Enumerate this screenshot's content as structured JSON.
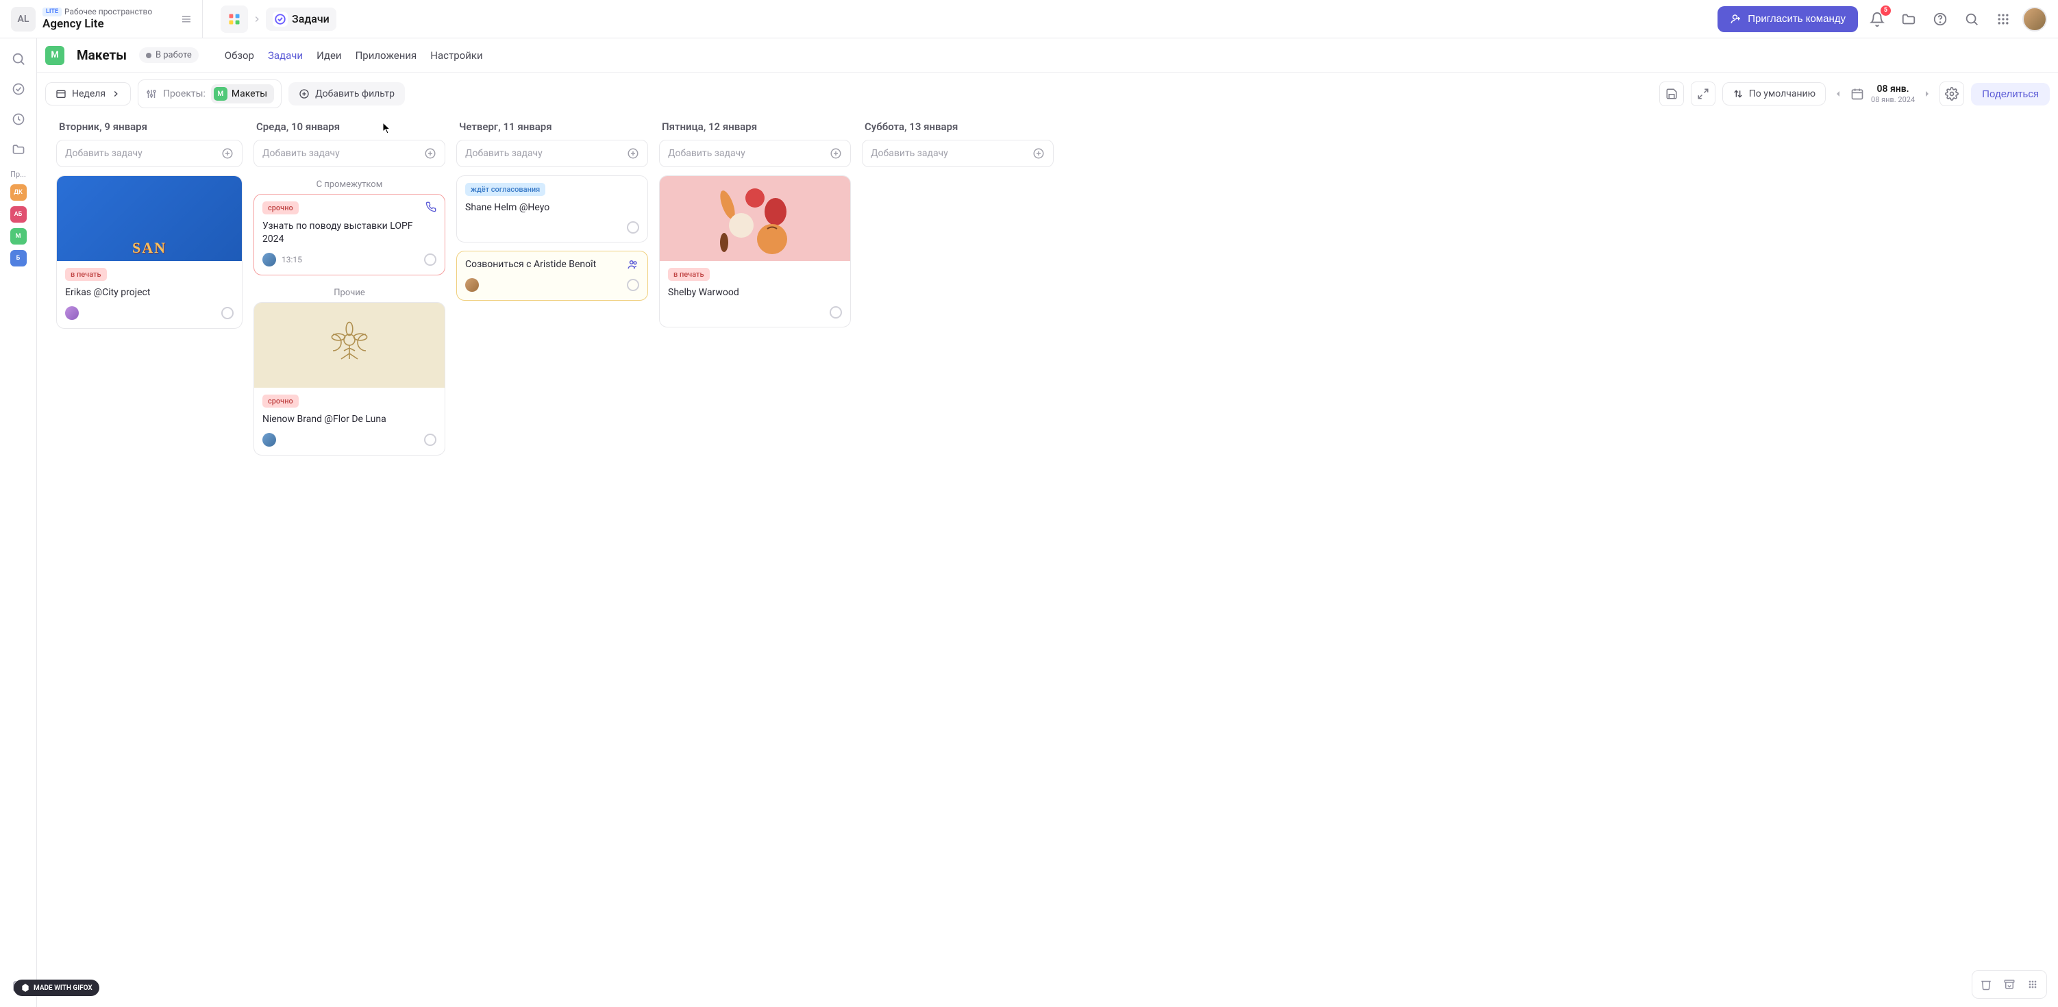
{
  "workspace": {
    "badge": "AL",
    "lite": "LITE",
    "sublabel": "Рабочее пространство",
    "name": "Agency Lite"
  },
  "breadcrumb": {
    "page": "Задачи"
  },
  "top_actions": {
    "invite": "Пригласить команду",
    "notif_count": "5"
  },
  "sidebar": {
    "projects_label": "Пр...",
    "avatars": [
      {
        "label": "ДК"
      },
      {
        "label": "АБ"
      },
      {
        "label": "М"
      },
      {
        "label": "Б"
      }
    ]
  },
  "subheader": {
    "proj_badge": "М",
    "proj_title": "Макеты",
    "status": "В работе",
    "nav": {
      "overview": "Обзор",
      "tasks": "Задачи",
      "ideas": "Идеи",
      "apps": "Приложения",
      "settings": "Настройки"
    }
  },
  "toolbar": {
    "week": "Неделя",
    "projects_label": "Проекты:",
    "proj_chip": "Макеты",
    "proj_chip_badge": "М",
    "add_filter": "Добавить фильтр",
    "sort": "По умолчанию",
    "date_main": "08 янв.",
    "date_sub": "08 янв. 2024",
    "share": "Поделиться"
  },
  "columns": [
    {
      "header": "Вторник, 9 января",
      "add_placeholder": "Добавить задачу",
      "sections": [
        {
          "cards": [
            {
              "type": "image-card",
              "img": "san",
              "img_text": "SAN",
              "tag": {
                "cls": "tag-print",
                "text": "в печать"
              },
              "title": "Erikas @City project",
              "assignee": "a1"
            }
          ]
        }
      ]
    },
    {
      "header": "Среда, 10 января",
      "add_placeholder": "Добавить задачу",
      "sections": [
        {
          "label": "С промежутком",
          "cards": [
            {
              "type": "text-card",
              "urgent": true,
              "tag": {
                "cls": "tag-urgent",
                "text": "срочно"
              },
              "title": "Узнать по поводу выставки LOPF 2024",
              "phone": true,
              "assignee": "a2",
              "time": "13:15"
            }
          ]
        },
        {
          "label": "Прочие",
          "cards": [
            {
              "type": "image-card",
              "img": "flor",
              "tag": {
                "cls": "tag-urgent",
                "text": "срочно"
              },
              "title": "Nienow Brand @Flor De Luna",
              "assignee": "a2"
            }
          ]
        }
      ]
    },
    {
      "header": "Четверг, 11 января",
      "add_placeholder": "Добавить задачу",
      "sections": [
        {
          "cards": [
            {
              "type": "text-card",
              "tag": {
                "cls": "tag-wait",
                "text": "ждёт согласования"
              },
              "title": "Shane Helm @Heyo"
            },
            {
              "type": "text-card",
              "yellow": true,
              "title": "Созвониться с Aristide Benoît",
              "people": true,
              "assignee": "a3"
            }
          ]
        }
      ]
    },
    {
      "header": "Пятница, 12 января",
      "add_placeholder": "Добавить задачу",
      "sections": [
        {
          "cards": [
            {
              "type": "image-card",
              "img": "veg",
              "tag": {
                "cls": "tag-print",
                "text": "в печать"
              },
              "title": "Shelby Warwood"
            }
          ]
        }
      ]
    },
    {
      "header": "Суббота, 13 января",
      "add_placeholder": "Добавить задачу",
      "sections": []
    }
  ],
  "gifox": "MADE WITH GIFOX"
}
